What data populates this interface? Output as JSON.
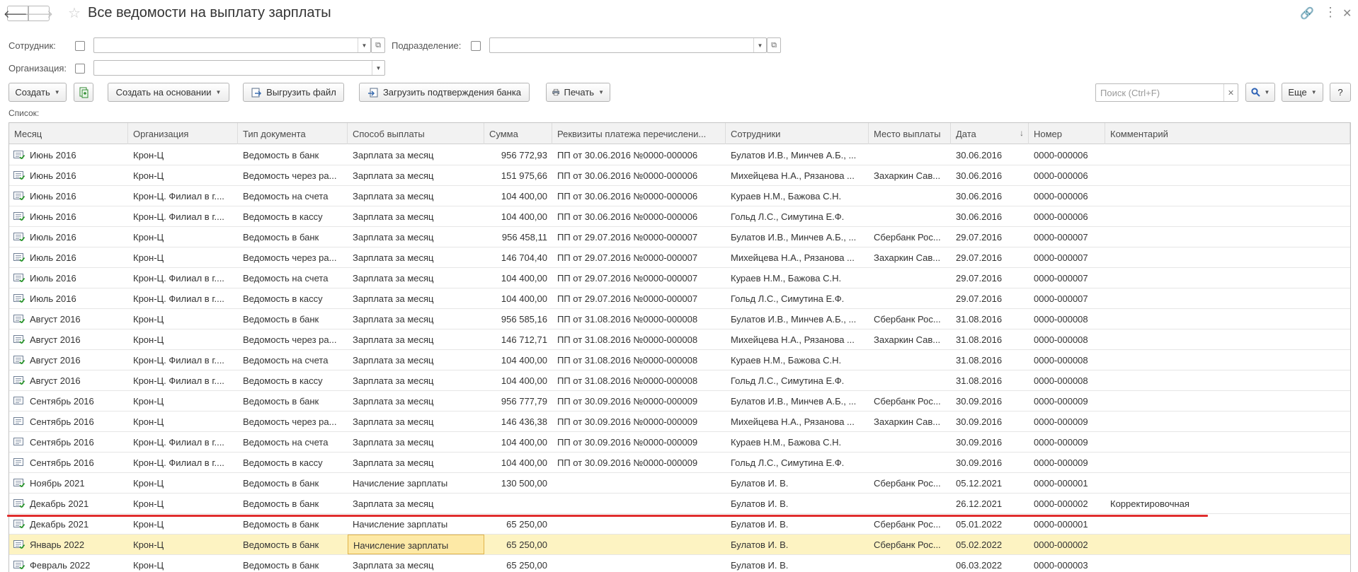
{
  "window": {
    "title": "Все ведомости на выплату зарплаты"
  },
  "filters": {
    "employee_label": "Сотрудник:",
    "department_label": "Подразделение:",
    "organization_label": "Организация:"
  },
  "toolbar": {
    "create": "Создать",
    "create_basis": "Создать на основании",
    "export_file": "Выгрузить файл",
    "import_bank": "Загрузить подтверждения банка",
    "print": "Печать",
    "search_placeholder": "Поиск (Ctrl+F)",
    "more": "Еще",
    "help": "?"
  },
  "list_label": "Список:",
  "table": {
    "columns": [
      "Месяц",
      "Организация",
      "Тип документа",
      "Способ выплаты",
      "Сумма",
      "Реквизиты платежа перечислени...",
      "Сотрудники",
      "Место выплаты",
      "Дата",
      "Номер",
      "Комментарий"
    ],
    "sort_indicator": "↓",
    "rows": [
      {
        "icon": "doc-posted-icon",
        "c": [
          "Июнь 2016",
          "Крон-Ц",
          "Ведомость в банк",
          "Зарплата за месяц",
          "956 772,93",
          "ПП от 30.06.2016 №0000-000006",
          "Булатов И.В., Минчев А.Б., ...",
          "",
          "30.06.2016",
          "0000-000006",
          ""
        ]
      },
      {
        "icon": "doc-posted-icon",
        "c": [
          "Июнь 2016",
          "Крон-Ц",
          "Ведомость через ра...",
          "Зарплата за месяц",
          "151 975,66",
          "ПП от 30.06.2016 №0000-000006",
          "Михейцева Н.А., Рязанова ...",
          "Захаркин Сав...",
          "30.06.2016",
          "0000-000006",
          ""
        ]
      },
      {
        "icon": "doc-posted-icon",
        "c": [
          "Июнь 2016",
          "Крон-Ц. Филиал в г....",
          "Ведомость на счета",
          "Зарплата за месяц",
          "104 400,00",
          "ПП от 30.06.2016 №0000-000006",
          "Кураев Н.М., Бажова С.Н.",
          "",
          "30.06.2016",
          "0000-000006",
          ""
        ]
      },
      {
        "icon": "doc-posted-icon",
        "c": [
          "Июнь 2016",
          "Крон-Ц. Филиал в г....",
          "Ведомость в кассу",
          "Зарплата за месяц",
          "104 400,00",
          "ПП от 30.06.2016 №0000-000006",
          "Гольд Л.С., Симутина Е.Ф.",
          "",
          "30.06.2016",
          "0000-000006",
          ""
        ]
      },
      {
        "icon": "doc-posted-icon",
        "c": [
          "Июль 2016",
          "Крон-Ц",
          "Ведомость в банк",
          "Зарплата за месяц",
          "956 458,11",
          "ПП от 29.07.2016 №0000-000007",
          "Булатов И.В., Минчев А.Б., ...",
          "Сбербанк Рос...",
          "29.07.2016",
          "0000-000007",
          ""
        ]
      },
      {
        "icon": "doc-posted-icon",
        "c": [
          "Июль 2016",
          "Крон-Ц",
          "Ведомость через ра...",
          "Зарплата за месяц",
          "146 704,40",
          "ПП от 29.07.2016 №0000-000007",
          "Михейцева Н.А., Рязанова ...",
          "Захаркин Сав...",
          "29.07.2016",
          "0000-000007",
          ""
        ]
      },
      {
        "icon": "doc-posted-icon",
        "c": [
          "Июль 2016",
          "Крон-Ц. Филиал в г....",
          "Ведомость на счета",
          "Зарплата за месяц",
          "104 400,00",
          "ПП от 29.07.2016 №0000-000007",
          "Кураев Н.М., Бажова С.Н.",
          "",
          "29.07.2016",
          "0000-000007",
          ""
        ]
      },
      {
        "icon": "doc-posted-icon",
        "c": [
          "Июль 2016",
          "Крон-Ц. Филиал в г....",
          "Ведомость в кассу",
          "Зарплата за месяц",
          "104 400,00",
          "ПП от 29.07.2016 №0000-000007",
          "Гольд Л.С., Симутина Е.Ф.",
          "",
          "29.07.2016",
          "0000-000007",
          ""
        ]
      },
      {
        "icon": "doc-posted-icon",
        "c": [
          "Август 2016",
          "Крон-Ц",
          "Ведомость в банк",
          "Зарплата за месяц",
          "956 585,16",
          "ПП от 31.08.2016 №0000-000008",
          "Булатов И.В., Минчев А.Б., ...",
          "Сбербанк Рос...",
          "31.08.2016",
          "0000-000008",
          ""
        ]
      },
      {
        "icon": "doc-posted-icon",
        "c": [
          "Август 2016",
          "Крон-Ц",
          "Ведомость через ра...",
          "Зарплата за месяц",
          "146 712,71",
          "ПП от 31.08.2016 №0000-000008",
          "Михейцева Н.А., Рязанова ...",
          "Захаркин Сав...",
          "31.08.2016",
          "0000-000008",
          ""
        ]
      },
      {
        "icon": "doc-posted-icon",
        "c": [
          "Август 2016",
          "Крон-Ц. Филиал в г....",
          "Ведомость на счета",
          "Зарплата за месяц",
          "104 400,00",
          "ПП от 31.08.2016 №0000-000008",
          "Кураев Н.М., Бажова С.Н.",
          "",
          "31.08.2016",
          "0000-000008",
          ""
        ]
      },
      {
        "icon": "doc-posted-icon",
        "c": [
          "Август 2016",
          "Крон-Ц. Филиал в г....",
          "Ведомость в кассу",
          "Зарплата за месяц",
          "104 400,00",
          "ПП от 31.08.2016 №0000-000008",
          "Гольд Л.С., Симутина Е.Ф.",
          "",
          "31.08.2016",
          "0000-000008",
          ""
        ]
      },
      {
        "icon": "doc-unposted-icon",
        "c": [
          "Сентябрь 2016",
          "Крон-Ц",
          "Ведомость в банк",
          "Зарплата за месяц",
          "956 777,79",
          "ПП от 30.09.2016 №0000-000009",
          "Булатов И.В., Минчев А.Б., ...",
          "Сбербанк Рос...",
          "30.09.2016",
          "0000-000009",
          ""
        ]
      },
      {
        "icon": "doc-unposted-icon",
        "c": [
          "Сентябрь 2016",
          "Крон-Ц",
          "Ведомость через ра...",
          "Зарплата за месяц",
          "146 436,38",
          "ПП от 30.09.2016 №0000-000009",
          "Михейцева Н.А., Рязанова ...",
          "Захаркин Сав...",
          "30.09.2016",
          "0000-000009",
          ""
        ]
      },
      {
        "icon": "doc-unposted-icon",
        "c": [
          "Сентябрь 2016",
          "Крон-Ц. Филиал в г....",
          "Ведомость на счета",
          "Зарплата за месяц",
          "104 400,00",
          "ПП от 30.09.2016 №0000-000009",
          "Кураев Н.М., Бажова С.Н.",
          "",
          "30.09.2016",
          "0000-000009",
          ""
        ]
      },
      {
        "icon": "doc-unposted-icon",
        "c": [
          "Сентябрь 2016",
          "Крон-Ц. Филиал в г....",
          "Ведомость в кассу",
          "Зарплата за месяц",
          "104 400,00",
          "ПП от 30.09.2016 №0000-000009",
          "Гольд Л.С., Симутина Е.Ф.",
          "",
          "30.09.2016",
          "0000-000009",
          ""
        ]
      },
      {
        "icon": "doc-posted-icon",
        "c": [
          "Ноябрь 2021",
          "Крон-Ц",
          "Ведомость в банк",
          "Начисление зарплаты",
          "130 500,00",
          "",
          "Булатов И. В.",
          "Сбербанк Рос...",
          "05.12.2021",
          "0000-000001",
          ""
        ]
      },
      {
        "icon": "doc-posted-icon",
        "c": [
          "Декабрь 2021",
          "Крон-Ц",
          "Ведомость в банк",
          "Зарплата за месяц",
          "",
          "",
          "Булатов И. В.",
          "",
          "26.12.2021",
          "0000-000002",
          "Корректировочная"
        ]
      },
      {
        "icon": "doc-posted-icon",
        "c": [
          "Декабрь 2021",
          "Крон-Ц",
          "Ведомость в банк",
          "Начисление зарплаты",
          "65 250,00",
          "",
          "Булатов И. В.",
          "Сбербанк Рос...",
          "05.01.2022",
          "0000-000001",
          ""
        ]
      },
      {
        "icon": "doc-posted-icon",
        "selected": true,
        "c": [
          "Январь 2022",
          "Крон-Ц",
          "Ведомость в банк",
          "Начисление зарплаты",
          "65 250,00",
          "",
          "Булатов И. В.",
          "Сбербанк Рос...",
          "05.02.2022",
          "0000-000002",
          ""
        ]
      },
      {
        "icon": "doc-posted-icon",
        "c": [
          "Февраль 2022",
          "Крон-Ц",
          "Ведомость в банк",
          "Зарплата за месяц",
          "65 250,00",
          "",
          "Булатов И. В.",
          "",
          "06.03.2022",
          "0000-000003",
          ""
        ]
      }
    ]
  }
}
